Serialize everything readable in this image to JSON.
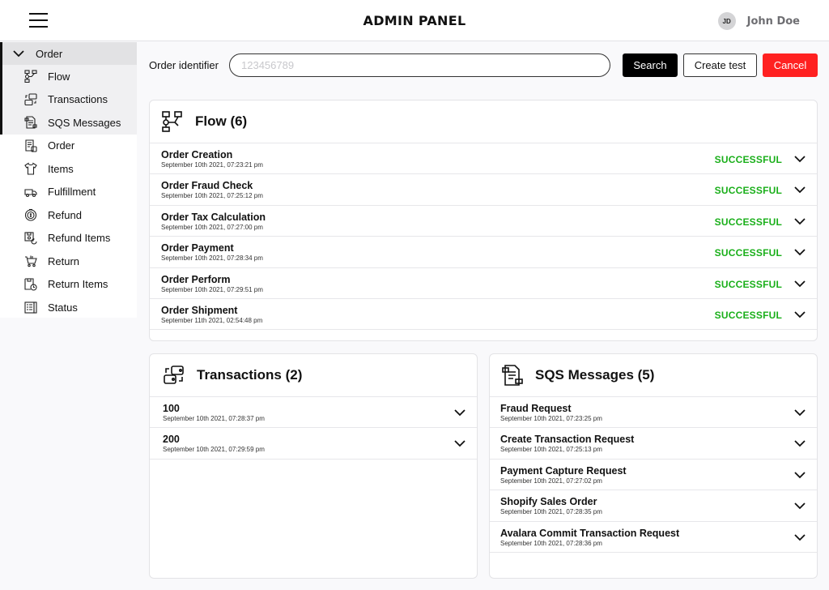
{
  "header": {
    "title": "ADMIN PANEL",
    "user": {
      "initials": "JD",
      "name": "John Doe"
    }
  },
  "sidebar": {
    "group": {
      "label": "Order",
      "expanded": true,
      "items": [
        {
          "label": "Flow",
          "icon": "flow-icon"
        },
        {
          "label": "Transactions",
          "icon": "transactions-icon"
        },
        {
          "label": "SQS Messages",
          "icon": "sqs-messages-icon"
        }
      ]
    },
    "items": [
      {
        "label": "Order",
        "icon": "order-icon"
      },
      {
        "label": "Items",
        "icon": "tshirt-icon"
      },
      {
        "label": "Fulfillment",
        "icon": "truck-icon"
      },
      {
        "label": "Refund",
        "icon": "refund-icon"
      },
      {
        "label": "Refund Items",
        "icon": "refund-items-icon"
      },
      {
        "label": "Return",
        "icon": "cart-icon"
      },
      {
        "label": "Return Items",
        "icon": "return-items-icon"
      },
      {
        "label": "Status",
        "icon": "status-icon"
      }
    ]
  },
  "search": {
    "label": "Order identifier",
    "value": "",
    "placeholder": "123456789",
    "search_button": "Search",
    "create_button": "Create test",
    "cancel_button": "Cancel"
  },
  "colors": {
    "success": "#1aaf1a",
    "cancel": "#ff2121",
    "primary": "#000000"
  },
  "flow": {
    "title": "Flow (6)",
    "rows": [
      {
        "title": "Order Creation",
        "date": "September 10th 2021, 07:23:21 pm",
        "status": "SUCCESSFUL"
      },
      {
        "title": "Order Fraud Check",
        "date": "September 10th 2021, 07:25:12 pm",
        "status": "SUCCESSFUL"
      },
      {
        "title": "Order Tax Calculation",
        "date": "September 10th 2021, 07:27:00 pm",
        "status": "SUCCESSFUL"
      },
      {
        "title": "Order Payment",
        "date": "September 10th 2021, 07:28:34 pm",
        "status": "SUCCESSFUL"
      },
      {
        "title": "Order Perform",
        "date": "September 10th 2021, 07:29:51 pm",
        "status": "SUCCESSFUL"
      },
      {
        "title": "Order Shipment",
        "date": "September 11th 2021, 02:54:48 pm",
        "status": "SUCCESSFUL"
      }
    ]
  },
  "transactions": {
    "title": "Transactions (2)",
    "rows": [
      {
        "title": "100",
        "date": "September 10th 2021, 07:28:37 pm"
      },
      {
        "title": "200",
        "date": "September 10th 2021, 07:29:59 pm"
      }
    ]
  },
  "sqs": {
    "title": "SQS Messages (5)",
    "rows": [
      {
        "title": "Fraud Request",
        "date": "September 10th 2021, 07:23:25 pm"
      },
      {
        "title": "Create Transaction Request",
        "date": "September 10th 2021, 07:25:13 pm"
      },
      {
        "title": "Payment Capture Request",
        "date": "September 10th 2021, 07:27:02 pm"
      },
      {
        "title": "Shopify Sales Order",
        "date": "September 10th 2021, 07:28:35 pm"
      },
      {
        "title": "Avalara Commit Transaction Request",
        "date": "September 10th 2021, 07:28:36 pm"
      }
    ]
  }
}
